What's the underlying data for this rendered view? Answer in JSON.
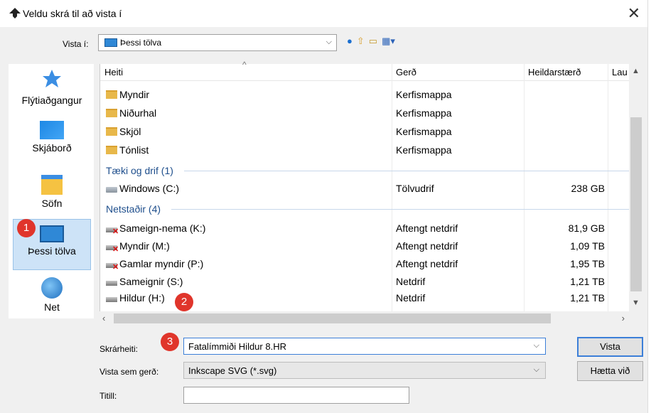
{
  "window": {
    "title": "Veldu skrá til að vista í"
  },
  "toolbar": {
    "location_label": "Vista í:",
    "location_value": "Þessi tölva"
  },
  "places": [
    {
      "label": "Flýtiaðgangur",
      "icon": "star-icon"
    },
    {
      "label": "Skjáborð",
      "icon": "desktop-icon"
    },
    {
      "label": "Söfn",
      "icon": "libraries-icon"
    },
    {
      "label": "Þessi tölva",
      "icon": "computer-icon",
      "selected": true
    },
    {
      "label": "Net",
      "icon": "network-icon"
    }
  ],
  "columns": {
    "name": "Heiti",
    "type": "Gerð",
    "size": "Heildarstærð",
    "free": "Lau"
  },
  "groups": {
    "devices": "Tæki og drif (1)",
    "network": "Netstaðir (4)"
  },
  "rows": [
    {
      "name": "Myndir",
      "type": "Kerfismappa",
      "size": "",
      "icon": "pictures-folder-icon"
    },
    {
      "name": "Niðurhal",
      "type": "Kerfismappa",
      "size": "",
      "icon": "downloads-folder-icon"
    },
    {
      "name": "Skjöl",
      "type": "Kerfismappa",
      "size": "",
      "icon": "documents-folder-icon"
    },
    {
      "name": "Tónlist",
      "type": "Kerfismappa",
      "size": "",
      "icon": "music-folder-icon"
    },
    {
      "name": "Windows (C:)",
      "type": "Tölvudrif",
      "size": "238 GB",
      "icon": "drive-icon"
    },
    {
      "name": "Sameign-nema (K:)",
      "type": "Aftengt netdrif",
      "size": "81,9 GB",
      "icon": "disconnected-network-drive-icon"
    },
    {
      "name": "Myndir (M:)",
      "type": "Aftengt netdrif",
      "size": "1,09 TB",
      "icon": "disconnected-network-drive-icon"
    },
    {
      "name": "Gamlar myndir (P:)",
      "type": "Aftengt netdrif",
      "size": "1,95 TB",
      "icon": "disconnected-network-drive-icon"
    },
    {
      "name": "Sameignir (S:)",
      "type": "Netdrif",
      "size": "1,21 TB",
      "icon": "network-drive-icon"
    },
    {
      "name": "Hildur (H:)",
      "type": "Netdrif",
      "size": "1,21 TB",
      "icon": "network-drive-icon"
    }
  ],
  "form": {
    "filename_label": "Skrárheiti:",
    "filename_value": "Fatalímmiði Hildur 8.HR",
    "filetype_label": "Vista sem gerð:",
    "filetype_value": "Inkscape SVG (*.svg)",
    "title_label": "Titill:",
    "title_value": ""
  },
  "buttons": {
    "save": "Vista",
    "cancel": "Hætta við"
  },
  "badges": [
    "1",
    "2",
    "3"
  ]
}
